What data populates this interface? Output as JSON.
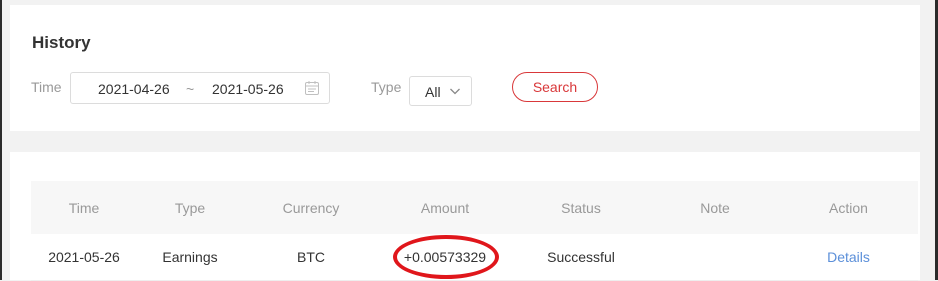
{
  "history": {
    "title": "History",
    "filters": {
      "time_label": "Time",
      "start_date": "2021-04-26",
      "range_separator": "~",
      "end_date": "2021-05-26",
      "type_label": "Type",
      "type_value": "All",
      "search_label": "Search"
    },
    "table": {
      "headers": [
        "Time",
        "Type",
        "Currency",
        "Amount",
        "Status",
        "Note",
        "Action"
      ],
      "rows": [
        {
          "time": "2021-05-26",
          "type": "Earnings",
          "currency": "BTC",
          "amount": "+0.00573329",
          "status": "Successful",
          "note": "",
          "action": "Details"
        }
      ]
    }
  },
  "colors": {
    "accent": "#d9383a",
    "link": "#5b8fd9",
    "annotation": "#e0161b"
  },
  "icons": {
    "date_picker": "calendar-icon",
    "type_dropdown": "chevron-down-icon"
  }
}
